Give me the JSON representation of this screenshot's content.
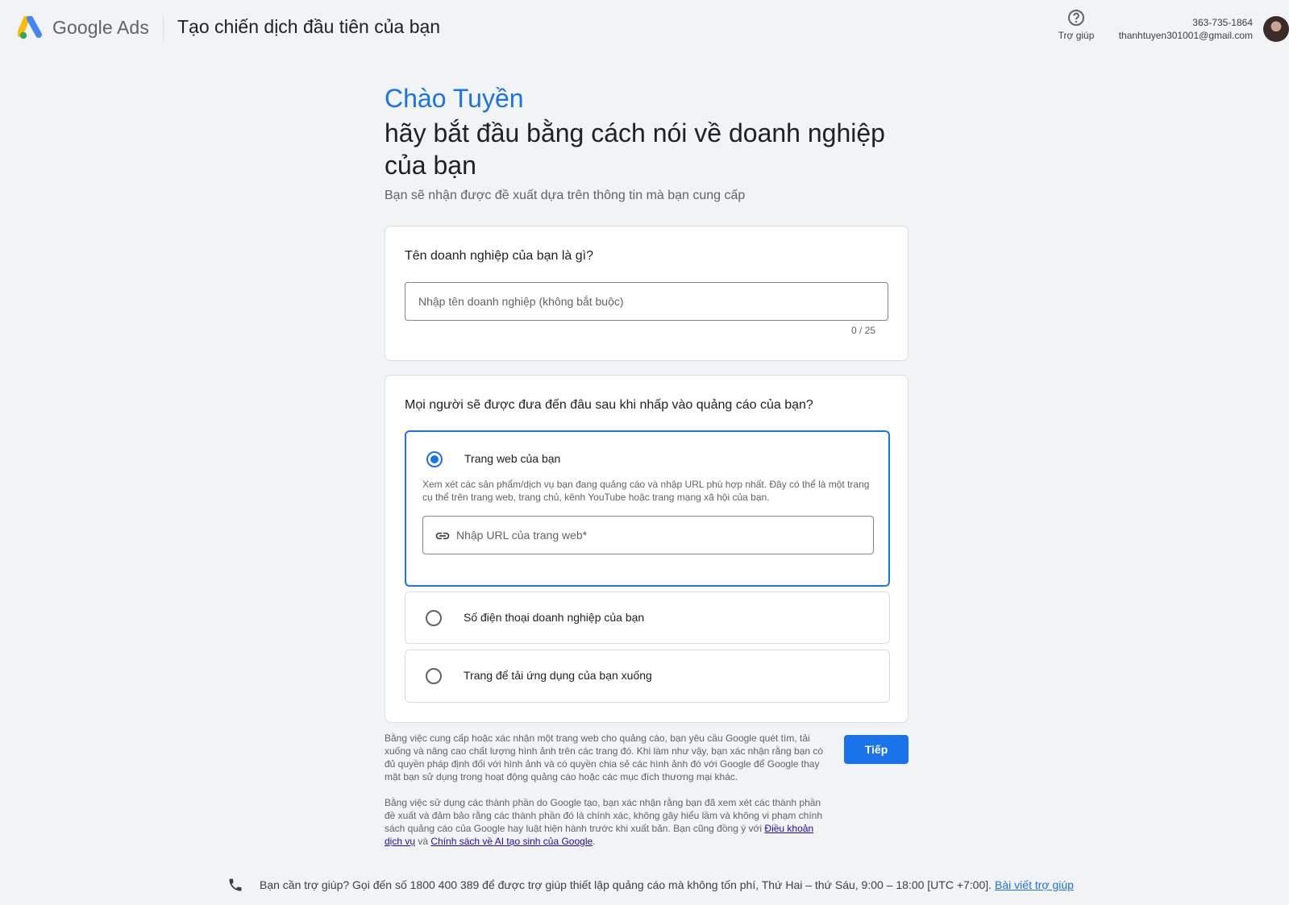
{
  "header": {
    "brand": "Google Ads",
    "title": "Tạo chiến dịch đầu tiên của bạn",
    "help_label": "Trợ giúp",
    "account_id": "363-735-1864",
    "account_email": "thanhtuyen301001@gmail.com"
  },
  "intro": {
    "greeting": "Chào Tuyền",
    "headline": "hãy bắt đầu bằng cách nói về doanh nghiệp của bạn",
    "subline": "Bạn sẽ nhận được đề xuất dựa trên thông tin mà bạn cung cấp"
  },
  "business": {
    "question": "Tên doanh nghiệp của bạn là gì?",
    "placeholder": "Nhập tên doanh nghiệp (không bắt buộc)",
    "value": "",
    "counter": "0 / 25"
  },
  "destination": {
    "question": "Mọi người sẽ được đưa đến đâu sau khi nhấp vào quảng cáo của bạn?",
    "options": [
      {
        "label": "Trang web của bạn",
        "selected": true,
        "description": "Xem xét các sản phẩm/dịch vụ bạn đang quảng cáo và nhập URL phù hợp nhất. Đây có thể là một trang cụ thể trên trang web, trang chủ, kênh YouTube hoặc trang mạng xã hội của bạn.",
        "url_placeholder": "Nhập URL của trang web*",
        "url_value": ""
      },
      {
        "label": "Số điện thoại doanh nghiệp của bạn",
        "selected": false
      },
      {
        "label": "Trang để tải ứng dụng của bạn xuống",
        "selected": false
      }
    ]
  },
  "legal": {
    "para1": "Bằng việc cung cấp hoặc xác nhận một trang web cho quảng cáo, bạn yêu cầu Google quét tìm, tải xuống và nâng cao chất lượng hình ảnh trên các trang đó. Khi làm như vậy, bạn xác nhận rằng bạn có đủ quyền pháp định đối với hình ảnh và có quyền chia sẻ các hình ảnh đó với Google để Google thay mặt bạn sử dụng trong hoạt động quảng cáo hoặc các mục đích thương mại khác.",
    "para2_text": "Bằng việc sử dụng các thành phần do Google tạo, bạn xác nhận rằng bạn đã xem xét các thành phần đề xuất và đảm bảo rằng các thành phần đó là chính xác, không gây hiểu lầm và không vi phạm chính sách quảng cáo của Google hay luật hiện hành trước khi xuất bản. Bạn cũng đồng ý với ",
    "terms_link": "Điều khoản dịch vụ",
    "and_word": " và ",
    "ai_policy_link": "Chính sách về AI tạo sinh của Google",
    "period": "."
  },
  "actions": {
    "next_label": "Tiếp"
  },
  "footer": {
    "text": "Bạn cần trợ giúp? Gọi đến số 1800 400 389 để được trợ giúp thiết lập quảng cáo mà không tốn phí, Thứ Hai – thứ Sáu, 9:00 – 18:00 [UTC +7:00].",
    "link": "Bài viết trợ giúp"
  },
  "colors": {
    "accent": "#1a73e8",
    "background": "#f1f3f4",
    "link": "#1a0dab"
  },
  "icons": [
    "google-ads-logo",
    "help-icon",
    "link-icon",
    "phone-icon"
  ]
}
